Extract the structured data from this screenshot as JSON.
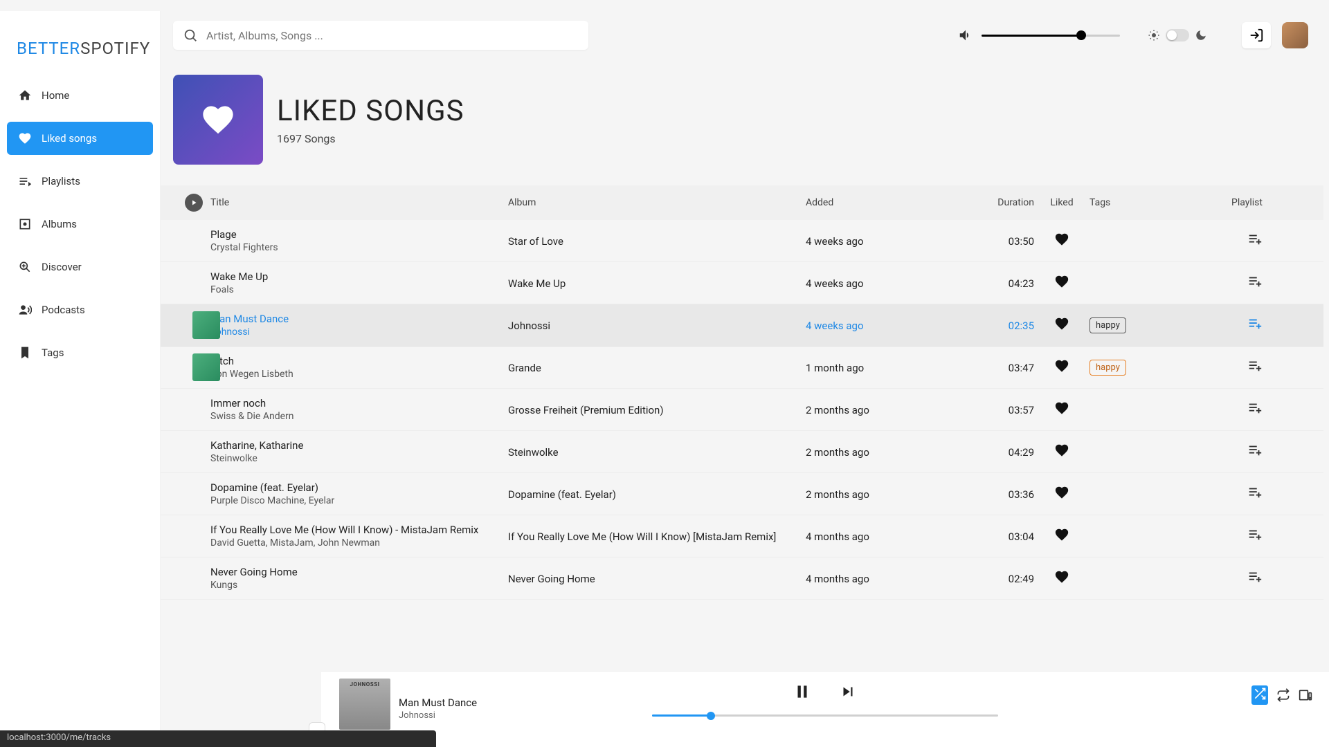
{
  "brand": {
    "part1": "BETTER",
    "part2": "SPOTIFY"
  },
  "search": {
    "placeholder": "Artist, Albums, Songs ..."
  },
  "sidebar": {
    "items": [
      {
        "label": "Home",
        "icon": "home"
      },
      {
        "label": "Liked songs",
        "icon": "heart",
        "active": true
      },
      {
        "label": "Playlists",
        "icon": "playlist"
      },
      {
        "label": "Albums",
        "icon": "album"
      },
      {
        "label": "Discover",
        "icon": "discover"
      },
      {
        "label": "Podcasts",
        "icon": "podcasts"
      },
      {
        "label": "Tags",
        "icon": "bookmark"
      }
    ]
  },
  "page": {
    "title": "LIKED SONGS",
    "subtitle": "1697 Songs"
  },
  "columns": {
    "title": "Title",
    "album": "Album",
    "added": "Added",
    "duration": "Duration",
    "liked": "Liked",
    "tags": "Tags",
    "playlist": "Playlist"
  },
  "tracks": [
    {
      "title": "Plage",
      "artist": "Crystal Fighters",
      "album": "Star of Love",
      "added": "4 weeks ago",
      "duration": "03:50",
      "tags": [],
      "active": false,
      "art": false
    },
    {
      "title": "Wake Me Up",
      "artist": "Foals",
      "album": "Wake Me Up",
      "added": "4 weeks ago",
      "duration": "04:23",
      "tags": [],
      "active": false,
      "art": false
    },
    {
      "title": "Man Must Dance",
      "artist": "Johnossi",
      "album": "Johnossi",
      "added": "4 weeks ago",
      "duration": "02:35",
      "tags": [
        "happy"
      ],
      "tagStyle": "dark",
      "active": true,
      "art": true
    },
    {
      "title": "Bitch",
      "artist": "Von Wegen Lisbeth",
      "album": "Grande",
      "added": "1 month ago",
      "duration": "03:47",
      "tags": [
        "happy"
      ],
      "tagStyle": "orange",
      "active": false,
      "art": true
    },
    {
      "title": "Immer noch",
      "artist": "Swiss & Die Andern",
      "album": "Grosse Freiheit (Premium Edition)",
      "added": "2 months ago",
      "duration": "03:57",
      "tags": [],
      "active": false,
      "art": false
    },
    {
      "title": "Katharine, Katharine",
      "artist": "Steinwolke",
      "album": "Steinwolke",
      "added": "2 months ago",
      "duration": "04:29",
      "tags": [],
      "active": false,
      "art": false
    },
    {
      "title": "Dopamine (feat. Eyelar)",
      "artist": "Purple Disco Machine, Eyelar",
      "album": "Dopamine (feat. Eyelar)",
      "added": "2 months ago",
      "duration": "03:36",
      "tags": [],
      "active": false,
      "art": false
    },
    {
      "title": "If You Really Love Me (How Will I Know) - MistaJam Remix",
      "artist": "David Guetta, MistaJam, John Newman",
      "album": "If You Really Love Me (How Will I Know) [MistaJam Remix]",
      "added": "4 months ago",
      "duration": "03:04",
      "tags": [],
      "active": false,
      "art": false
    },
    {
      "title": "Never Going Home",
      "artist": "Kungs",
      "album": "Never Going Home",
      "added": "4 months ago",
      "duration": "02:49",
      "tags": [],
      "active": false,
      "art": false
    }
  ],
  "player": {
    "art_label": "JOHNOSSI",
    "title": "Man Must Dance",
    "artist": "Johnossi",
    "progress_percent": 17
  },
  "volume_percent": 72,
  "status_text": "localhost:3000/me/tracks"
}
